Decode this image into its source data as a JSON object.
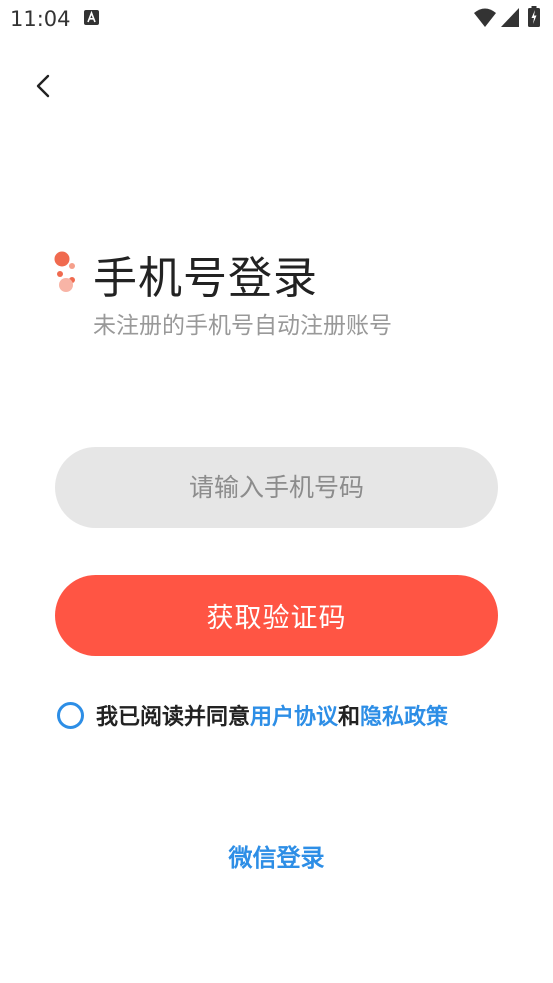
{
  "status_bar": {
    "time": "11:04",
    "notification_icon": "a-box-notification-icon",
    "wifi_icon": "wifi-icon",
    "signal_icon": "cell-signal-icon",
    "battery_icon": "battery-charging-icon"
  },
  "header": {
    "back_icon": "chevron-left-icon",
    "title": "手机号登录",
    "subtitle": "未注册的手机号自动注册账号",
    "decoration_icon": "dots-decoration-icon"
  },
  "form": {
    "phone_placeholder": "请输入手机号码",
    "phone_value": "",
    "get_code_label": "获取验证码"
  },
  "agreement": {
    "checked": false,
    "prefix": "我已阅读并同意",
    "user_agreement": "用户协议",
    "conjunction": "和",
    "privacy_policy": "隐私政策"
  },
  "alt_login": {
    "wechat_label": "微信登录"
  },
  "colors": {
    "accent": "#ff5544",
    "link": "#2d8ee6",
    "input_bg": "#e6e6e6",
    "title": "#222222",
    "subtitle": "#999999"
  }
}
